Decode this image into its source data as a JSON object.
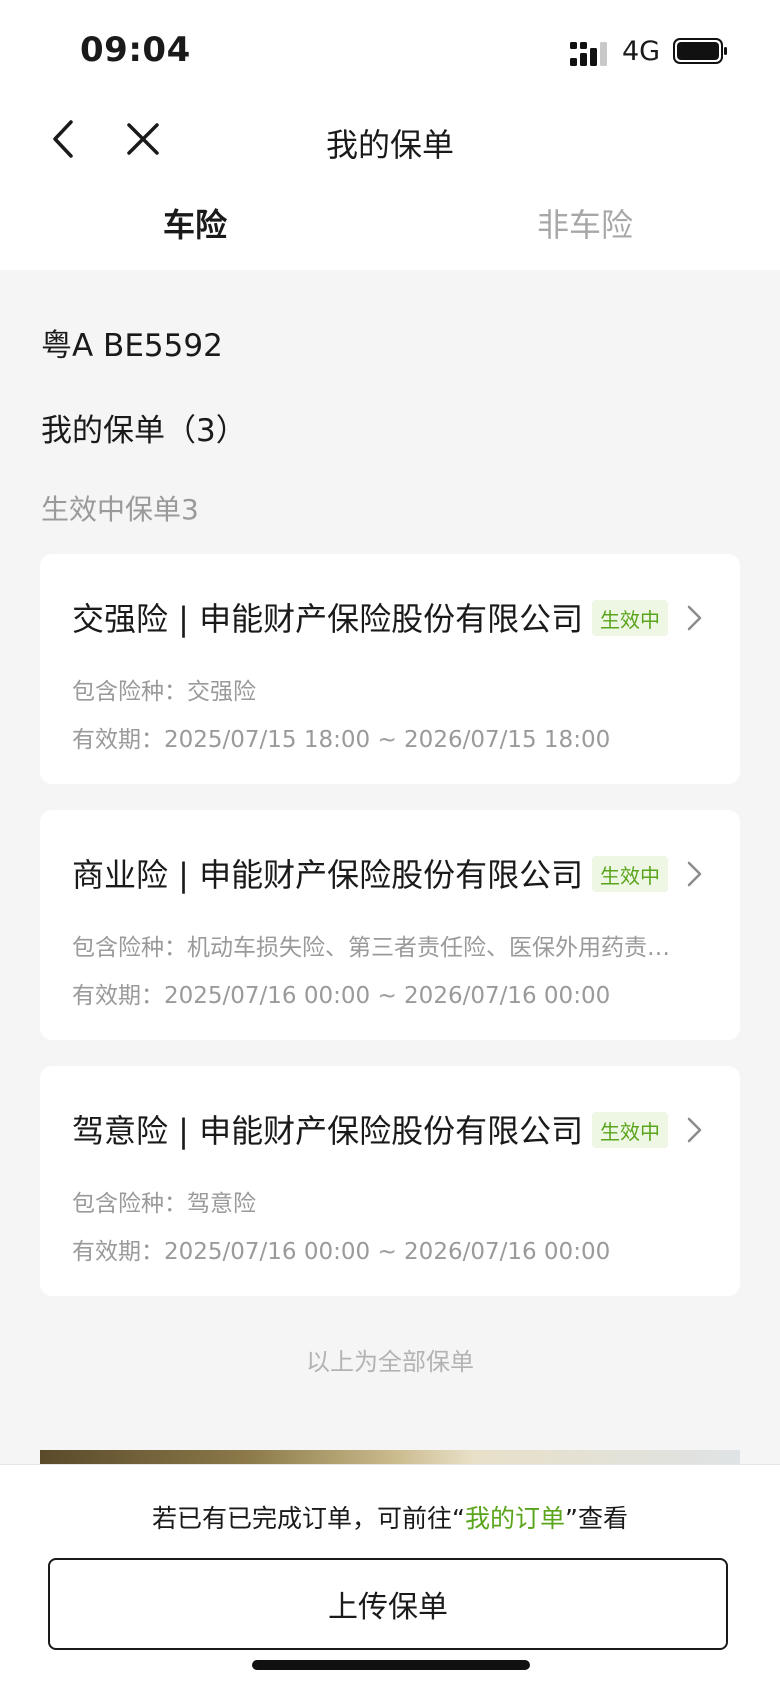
{
  "status_bar": {
    "time": "09:04",
    "network": "4G"
  },
  "nav": {
    "title": "我的保单"
  },
  "tabs": [
    {
      "label": "车险",
      "active": true
    },
    {
      "label": "非车险",
      "active": false
    }
  ],
  "plate_number": "粤A BE5592",
  "section": {
    "title": "我的保单（3）",
    "active_count_label": "生效中保单3"
  },
  "policies": [
    {
      "title": "交强险 | 申能财产保险股份有限公司",
      "status": "生效中",
      "coverage": "包含险种：交强险",
      "validity": "有效期：2025/07/15 18:00 ~ 2026/07/15 18:00"
    },
    {
      "title": "商业险 | 申能财产保险股份有限公司",
      "status": "生效中",
      "coverage": "包含险种：机动车损失险、第三者责任险、医保外用药责…",
      "validity": "有效期：2025/07/16 00:00 ~ 2026/07/16 00:00"
    },
    {
      "title": "驾意险 | 申能财产保险股份有限公司",
      "status": "生效中",
      "coverage": "包含险种：驾意险",
      "validity": "有效期：2025/07/16 00:00 ~ 2026/07/16 00:00"
    }
  ],
  "footer_note": "以上为全部保单",
  "bottom": {
    "hint_prefix": "若已有已完成订单，可前往“",
    "hint_link": "我的订单",
    "hint_suffix": "”查看",
    "upload_button": "上传保单"
  },
  "colors": {
    "accent_green": "#5aa51c",
    "badge_bg": "#eef6e4"
  }
}
